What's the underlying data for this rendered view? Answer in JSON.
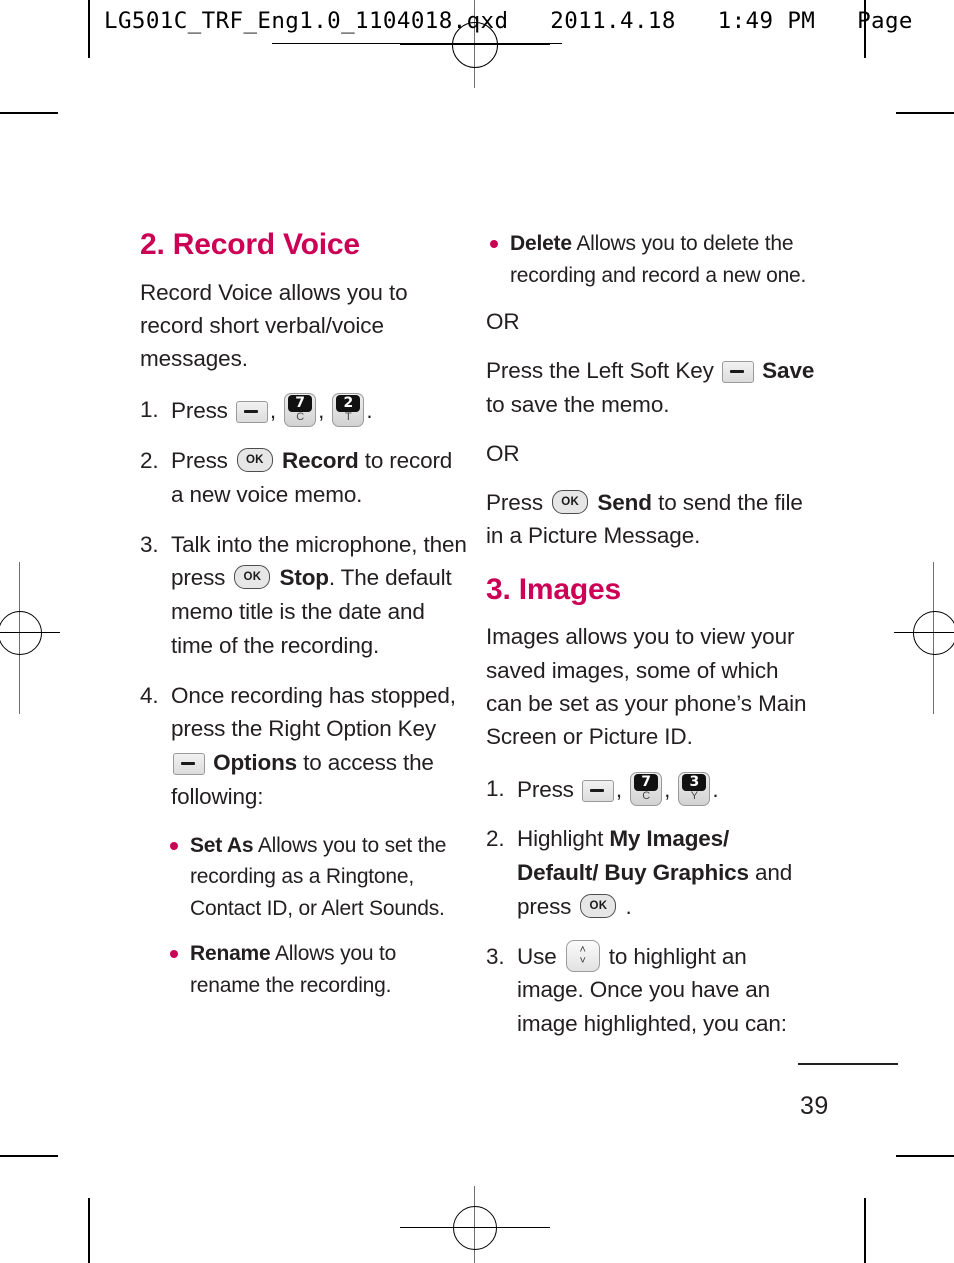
{
  "header": {
    "filename_line": "LG501C_TRF_Eng1.0_1104018.qxd   2011.4.18   1:49 PM   Page"
  },
  "colors": {
    "accent": "#cc0055",
    "body_text": "#231f20"
  },
  "left_column": {
    "section_title": "2. Record Voice",
    "intro": "Record Voice allows you to record short verbal/voice messages.",
    "steps": [
      {
        "number": "1.",
        "text_before": "Press",
        "keys": [
          "softkey",
          "7C",
          "2T"
        ],
        "text_after": "."
      },
      {
        "number": "2.",
        "text_before": "Press",
        "key": "OK",
        "bold": "Record",
        "text_after": "to record a new voice memo."
      },
      {
        "number": "3.",
        "text_before": "Talk into the microphone, then press",
        "key": "OK",
        "bold": "Stop",
        "text_after": ". The default memo title is the date and time of the recording."
      },
      {
        "number": "4.",
        "text_before": "Once recording has stopped, press the Right Option Key",
        "key": "softkey",
        "bold": "Options",
        "text_after": "to access the following:"
      }
    ],
    "bullets": [
      {
        "label": "Set As",
        "text": "Allows you to set the recording as a Ringtone, Contact ID, or Alert Sounds."
      },
      {
        "label": "Rename",
        "text": "Allows you to rename the recording."
      }
    ]
  },
  "right_column": {
    "bullets": [
      {
        "label": "Delete",
        "text": "Allows you to delete the recording and record a new one."
      }
    ],
    "or_1": "OR",
    "save_block": {
      "text_before": "Press the Left Soft Key",
      "key": "softkey",
      "bold": "Save",
      "text_after": "to save the memo."
    },
    "or_2": "OR",
    "send_block": {
      "text_before": "Press",
      "key": "OK",
      "bold": "Send",
      "text_after": "to send the file in a Picture Message."
    },
    "section_title": "3. Images",
    "intro": "Images allows you to view your saved images, some of which can be set as your phone’s Main Screen or Picture ID.",
    "steps": [
      {
        "number": "1.",
        "text_before": "Press",
        "keys": [
          "softkey",
          "7C",
          "3Y"
        ],
        "text_after": "."
      },
      {
        "number": "2.",
        "text_before": "Highlight",
        "bold": "My Images/ Default/ Buy Graphics",
        "text_mid": "and press",
        "key": "OK",
        "text_after": "."
      },
      {
        "number": "3.",
        "text_before": "Use",
        "key": "nav-updown",
        "text_after": "to highlight an image. Once you have an image highlighted, you can:"
      }
    ]
  },
  "footer": {
    "page_number": "39"
  },
  "keys": {
    "softkey": {
      "glyph": "—"
    },
    "ok": {
      "label": "OK"
    },
    "7C": {
      "digit": "7",
      "letter": "C"
    },
    "2T": {
      "digit": "2",
      "letter": "T"
    },
    "3Y": {
      "digit": "3",
      "letter": "Y"
    },
    "nav": {
      "up": "˄",
      "down": "˅"
    }
  }
}
